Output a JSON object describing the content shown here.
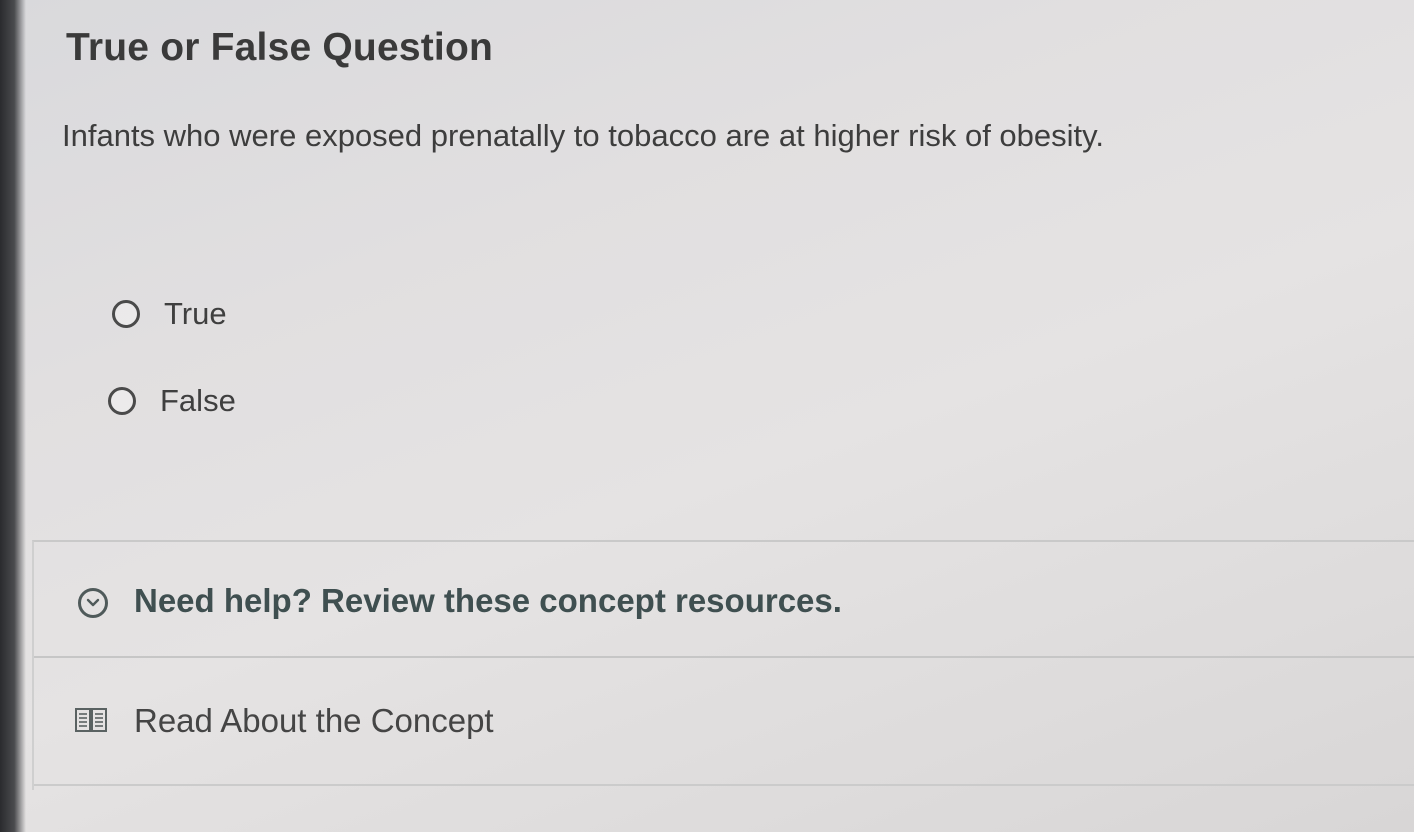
{
  "question": {
    "title": "True or False Question",
    "text": "Infants who were exposed prenatally to tobacco are at higher risk of obesity."
  },
  "options": [
    {
      "label": "True",
      "selected": false
    },
    {
      "label": "False",
      "selected": false
    }
  ],
  "help": {
    "header_label": "Need help? Review these concept resources.",
    "header_icon": "chevron-down-circle-icon",
    "resources": [
      {
        "label": "Read About the Concept",
        "icon": "book-icon"
      }
    ]
  }
}
